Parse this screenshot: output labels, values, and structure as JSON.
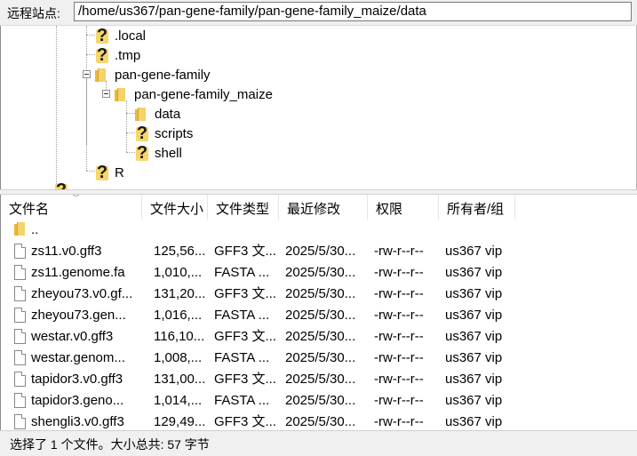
{
  "remote_site": {
    "label": "远程站点:",
    "path": "/home/us367/pan-gene-family/pan-gene-family_maize/data"
  },
  "tree": {
    "items": [
      {
        "label": ".local",
        "icon": "unknown-folder-icon"
      },
      {
        "label": ".tmp",
        "icon": "unknown-folder-icon"
      },
      {
        "label": "pan-gene-family",
        "icon": "folder-icon"
      },
      {
        "label": "pan-gene-family_maize",
        "icon": "folder-icon"
      },
      {
        "label": "data",
        "icon": "folder-icon"
      },
      {
        "label": "scripts",
        "icon": "unknown-folder-icon"
      },
      {
        "label": "shell",
        "icon": "unknown-folder-icon"
      },
      {
        "label": "R",
        "icon": "unknown-folder-icon"
      }
    ]
  },
  "file_list": {
    "columns": [
      "文件名",
      "文件大小",
      "文件类型",
      "最近修改",
      "权限",
      "所有者/组"
    ],
    "parent_label": "..",
    "rows": [
      {
        "name": "zs11.v0.gff3",
        "size": "125,56...",
        "type": "GFF3 文...",
        "modified": "2025/5/30...",
        "perms": "-rw-r--r--",
        "owner": "us367 vip"
      },
      {
        "name": "zs11.genome.fa",
        "size": "1,010,...",
        "type": "FASTA ...",
        "modified": "2025/5/30...",
        "perms": "-rw-r--r--",
        "owner": "us367 vip"
      },
      {
        "name": "zheyou73.v0.gf...",
        "size": "131,20...",
        "type": "GFF3 文...",
        "modified": "2025/5/30...",
        "perms": "-rw-r--r--",
        "owner": "us367 vip"
      },
      {
        "name": "zheyou73.gen...",
        "size": "1,016,...",
        "type": "FASTA ...",
        "modified": "2025/5/30...",
        "perms": "-rw-r--r--",
        "owner": "us367 vip"
      },
      {
        "name": "westar.v0.gff3",
        "size": "116,10...",
        "type": "GFF3 文...",
        "modified": "2025/5/30...",
        "perms": "-rw-r--r--",
        "owner": "us367 vip"
      },
      {
        "name": "westar.genom...",
        "size": "1,008,...",
        "type": "FASTA ...",
        "modified": "2025/5/30...",
        "perms": "-rw-r--r--",
        "owner": "us367 vip"
      },
      {
        "name": "tapidor3.v0.gff3",
        "size": "131,00...",
        "type": "GFF3 文...",
        "modified": "2025/5/30...",
        "perms": "-rw-r--r--",
        "owner": "us367 vip"
      },
      {
        "name": "tapidor3.geno...",
        "size": "1,014,...",
        "type": "FASTA ...",
        "modified": "2025/5/30...",
        "perms": "-rw-r--r--",
        "owner": "us367 vip"
      },
      {
        "name": "shengli3.v0.gff3",
        "size": "129,49...",
        "type": "GFF3 文...",
        "modified": "2025/5/30...",
        "perms": "-rw-r--r--",
        "owner": "us367 vip"
      }
    ]
  },
  "status": {
    "text": "选择了 1 个文件。大小总共: 57 字节"
  },
  "colors": {
    "folder": "#f5d26a",
    "unknown": "#f7d66b",
    "panel_bg": "#f0f0f0"
  }
}
